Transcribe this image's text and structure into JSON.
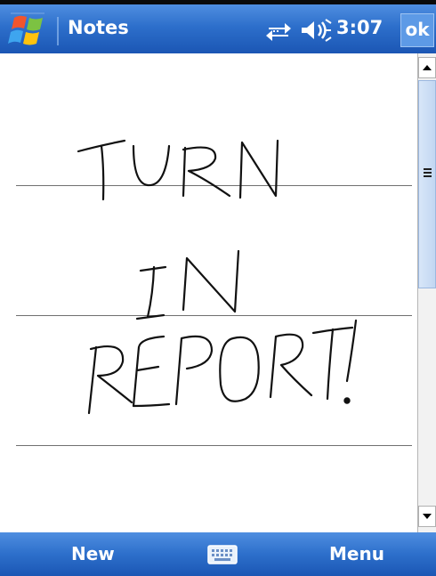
{
  "title_bar": {
    "app_title": "Notes",
    "time": "3:07",
    "ok_label": "ok",
    "icons": [
      "windows-start-icon",
      "connectivity-icon",
      "volume-icon"
    ]
  },
  "note": {
    "handwriting": [
      "TURN",
      "IN",
      "REPORT!"
    ],
    "ruled_lines": 3
  },
  "menu_bar": {
    "left_softkey": "New",
    "right_softkey": "Menu",
    "center_icon": "keyboard-icon"
  },
  "colors": {
    "bar_gradient_top": "#4f8ee0",
    "bar_gradient_bottom": "#1b56b4",
    "ink": "#111111",
    "rule": "#707070",
    "scroll_thumb": "#c2d7f2"
  }
}
